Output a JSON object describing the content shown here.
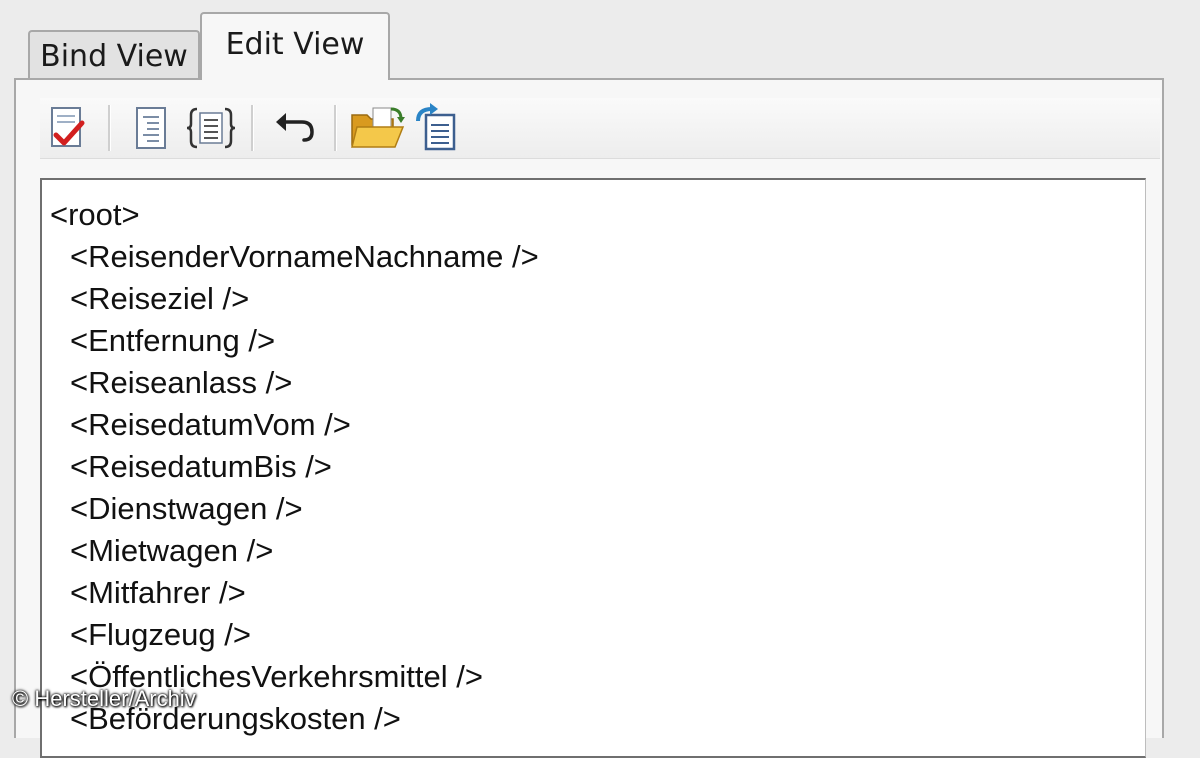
{
  "tabs": [
    {
      "label": "Bind View",
      "active": false
    },
    {
      "label": "Edit View",
      "active": true
    }
  ],
  "toolbar": {
    "buttons": [
      {
        "name": "validate-icon"
      },
      {
        "name": "document-outline-icon"
      },
      {
        "name": "format-braces-icon"
      },
      {
        "name": "undo-icon"
      },
      {
        "name": "open-folder-icon"
      },
      {
        "name": "refresh-document-icon"
      }
    ]
  },
  "editor": {
    "lines": [
      {
        "text": "<root>",
        "indent": false
      },
      {
        "text": "<ReisenderVornameNachname />",
        "indent": true
      },
      {
        "text": "<Reiseziel />",
        "indent": true
      },
      {
        "text": "<Entfernung />",
        "indent": true
      },
      {
        "text": "<Reiseanlass />",
        "indent": true
      },
      {
        "text": "<ReisedatumVom />",
        "indent": true
      },
      {
        "text": "<ReisedatumBis />",
        "indent": true
      },
      {
        "text": "<Dienstwagen />",
        "indent": true
      },
      {
        "text": "<Mietwagen />",
        "indent": true
      },
      {
        "text": "<Mitfahrer />",
        "indent": true
      },
      {
        "text": "<Flugzeug />",
        "indent": true
      },
      {
        "text": "<ÖffentlichesVerkehrsmittel />",
        "indent": true
      },
      {
        "text": "<Beförderungskosten />",
        "indent": true
      }
    ]
  },
  "watermark": "© Hersteller/Archiv",
  "colors": {
    "panel_bg": "#f7f7f7",
    "editor_bg": "#ffffff",
    "border": "#a8a8a8",
    "folder": "#e8b22c",
    "check": "#d21f1f"
  }
}
